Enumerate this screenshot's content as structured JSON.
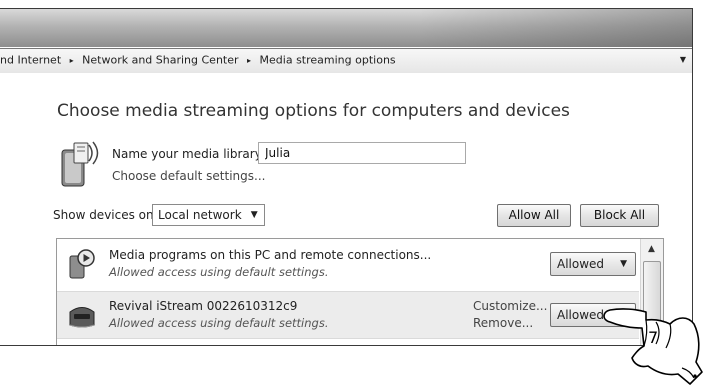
{
  "breadcrumb": {
    "items": [
      "nd Internet",
      "Network and Sharing Center",
      "Media streaming options"
    ],
    "separator": "▸",
    "dropdown_arrow": "▼"
  },
  "page": {
    "title": "Choose media streaming options for computers and devices"
  },
  "library": {
    "name_label": "Name your media library:",
    "name_value": "Julia",
    "default_link": "Choose default settings..."
  },
  "devices": {
    "show_label": "Show devices on:",
    "filter_value": "Local network",
    "allow_all_label": "Allow All",
    "block_all_label": "Block All",
    "rows": [
      {
        "title": "Media programs on this PC and remote connections...",
        "subtitle": "Allowed access using default settings.",
        "status": "Allowed",
        "icon": "media-player-icon"
      },
      {
        "title": "Revival iStream 0022610312c9",
        "subtitle": "Allowed access using default settings.",
        "customize_link": "Customize...",
        "remove_link": "Remove...",
        "status": "Allowed",
        "icon": "radio-device-icon"
      }
    ]
  },
  "annotation": {
    "step_number": "7"
  },
  "icons": {
    "arrow": "▼",
    "scroll_up": "▲"
  }
}
